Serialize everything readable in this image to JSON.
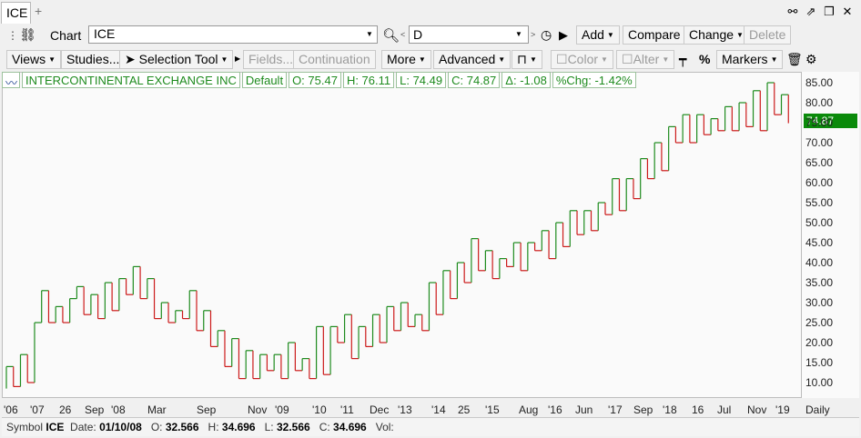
{
  "tab": {
    "title": "ICE",
    "add": "+"
  },
  "window_icons": [
    "link-break-icon",
    "popout-icon",
    "restore-icon",
    "close-icon"
  ],
  "toolbar": {
    "chart_label": "Chart",
    "symbol_value": "ICE",
    "period_value": "D",
    "add": "Add",
    "compare": "Compare",
    "change": "Change",
    "delete": "Delete",
    "views": "Views",
    "studies": "Studies...",
    "selection_tool": "Selection Tool",
    "fields": "Fields...",
    "continuation": "Continuation",
    "more": "More",
    "advanced": "Advanced",
    "color": "Color",
    "alter": "Alter",
    "percent": "%",
    "markers": "Markers"
  },
  "legend": {
    "name": "INTERCONTINENTAL EXCHANGE INC",
    "template": "Default",
    "open": "O: 75.47",
    "high": "H: 76.11",
    "low": "L: 74.49",
    "close": "C: 74.87",
    "delta": "Δ: -1.08",
    "pct": "%Chg: -1.42%"
  },
  "last_price": "74.87",
  "colors": {
    "up": "#1e8b1e",
    "down": "#cc1a1a",
    "price_tag": "#0a8a0a"
  },
  "chart_data": {
    "type": "line",
    "style": "kagi",
    "ylim": [
      8,
      88
    ],
    "y_ticks": [
      "85.00",
      "80.00",
      "75.00",
      "70.00",
      "65.00",
      "60.00",
      "55.00",
      "50.00",
      "45.00",
      "40.00",
      "35.00",
      "30.00",
      "25.00",
      "20.00",
      "15.00",
      "10.00"
    ],
    "x_ticks": [
      "'06",
      "'07",
      "26",
      "Sep",
      "'08",
      "Mar",
      "Sep",
      "Nov",
      "'09",
      "'10",
      "'11",
      "Dec",
      "'13",
      "'14",
      "25",
      "'15",
      "Aug",
      "'16",
      "Jun",
      "'17",
      "Sep",
      "'18",
      "16",
      "Jul",
      "Nov",
      "'19"
    ],
    "period_label": "Daily",
    "values": [
      8.5,
      14,
      9,
      17,
      10,
      25,
      33,
      25,
      29,
      25,
      31,
      34,
      27,
      32,
      26,
      35,
      28,
      36,
      32,
      39,
      31,
      36,
      26,
      30,
      25,
      28,
      26,
      33,
      23,
      28,
      19,
      23,
      14,
      21,
      11,
      18,
      11,
      17,
      13,
      17,
      11,
      20,
      13,
      16,
      11,
      24,
      12,
      24,
      20,
      27,
      16,
      24,
      19,
      27,
      20,
      29,
      23,
      30,
      24,
      27,
      23,
      35,
      27,
      38,
      31,
      40,
      35,
      46,
      38,
      43,
      36,
      41,
      39,
      45,
      38,
      45,
      43,
      48,
      41,
      50,
      44,
      53,
      47,
      53,
      48,
      55,
      52,
      61,
      53,
      61,
      56,
      66,
      61,
      70,
      63,
      74,
      70,
      77,
      70,
      77,
      72,
      76,
      73,
      79,
      73,
      80,
      74,
      83,
      73,
      85,
      77,
      82
    ],
    "last": 74.87
  },
  "status": {
    "symbol_label": "Symbol",
    "symbol": "ICE",
    "date_label": "Date:",
    "date": "01/10/08",
    "open_label": "O:",
    "open": "32.566",
    "high_label": "H:",
    "high": "34.696",
    "low_label": "L:",
    "low": "32.566",
    "close_label": "C:",
    "close": "34.696",
    "vol_label": "Vol:"
  }
}
